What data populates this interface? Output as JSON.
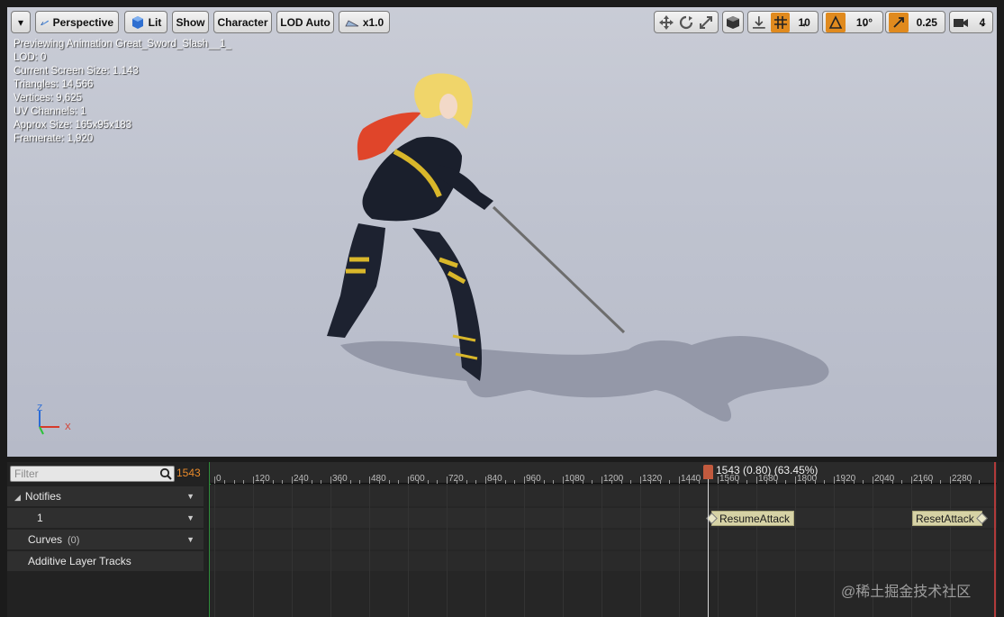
{
  "toolbar": {
    "menu_caret": "▾",
    "perspective": "Perspective",
    "lit": "Lit",
    "show": "Show",
    "character": "Character",
    "lod": "LOD Auto",
    "speed": "x1.0",
    "grid_snap": "10",
    "rotation_snap": "10°",
    "scale_snap": "0.25",
    "camera_speed": "4"
  },
  "stats": {
    "line1": "Previewing Animation Great_Sword_Slash__1_",
    "line2": "LOD: 0",
    "line3": "Current Screen Size: 1.143",
    "line4": "Triangles: 14,566",
    "line5": "Vertices: 9,625",
    "line6": "UV Channels: 1",
    "line7": "Approx Size: 165x95x183",
    "line8": "Framerate: 1,920"
  },
  "gizmo": {
    "z": "Z",
    "x": "X"
  },
  "timeline": {
    "filter_placeholder": "Filter",
    "frame": "1543",
    "notifies_label": "Notifies",
    "track_1_label": "1",
    "curves_label": "Curves",
    "curves_count": "(0)",
    "additive_label": "Additive Layer Tracks",
    "scrub_text": "1543 (0.80) (63.45%)",
    "ticks": [
      "0",
      "120",
      "240",
      "360",
      "480",
      "600",
      "720",
      "840",
      "960",
      "1080",
      "1200",
      "1320",
      "1440",
      "1560",
      "1680",
      "1800",
      "1920",
      "2040",
      "2160",
      "2280"
    ],
    "notify_1": "ResumeAttack",
    "notify_2": "ResetAttack"
  },
  "watermark": "@稀土掘金技术社区",
  "colors": {
    "accent_orange": "#e08a1e",
    "frame_orange": "#e88a2a",
    "notify_bg": "#d6d2a5",
    "scrub_handle": "#c25a3e"
  }
}
